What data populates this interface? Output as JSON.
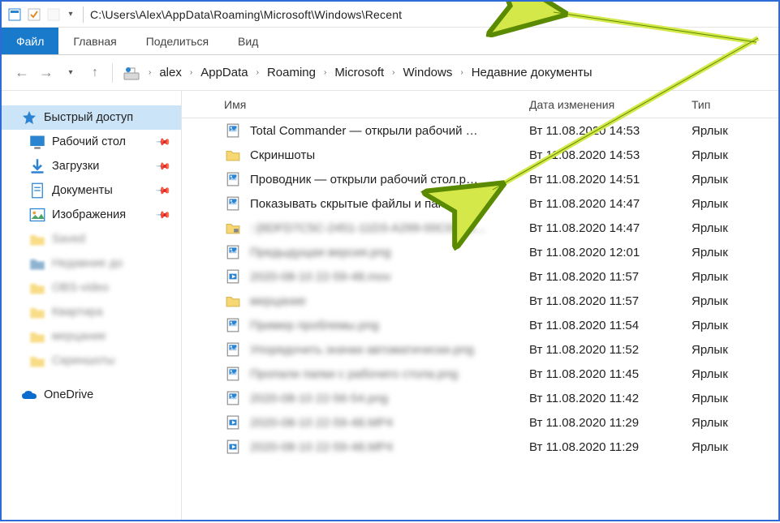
{
  "titlebar": {
    "path": "C:\\Users\\Alex\\AppData\\Roaming\\Microsoft\\Windows\\Recent"
  },
  "ribbon": {
    "file": "Файл",
    "home": "Главная",
    "share": "Поделиться",
    "view": "Вид"
  },
  "breadcrumb": {
    "items": [
      "alex",
      "AppData",
      "Roaming",
      "Microsoft",
      "Windows",
      "Недавние документы"
    ]
  },
  "sidebar": {
    "quick_access": "Быстрый доступ",
    "desktop": "Рабочий стол",
    "downloads": "Загрузки",
    "documents": "Документы",
    "pictures": "Изображения",
    "b5": "Saved",
    "b6": "Недавние до",
    "b7": "OBS-video",
    "b8": "Квартира",
    "b9": "мерцание",
    "b10": "Скриншоты",
    "onedrive": "OneDrive"
  },
  "columns": {
    "name": "Имя",
    "date": "Дата изменения",
    "type": "Тип"
  },
  "files": [
    {
      "icon": "image-file",
      "name": "Total Commander — открыли рабочий …",
      "date": "Вт 11.08.2020 14:53",
      "type": "Ярлык",
      "blur": false
    },
    {
      "icon": "folder",
      "name": "Скриншоты",
      "date": "Вт 11.08.2020 14:53",
      "type": "Ярлык",
      "blur": false
    },
    {
      "icon": "image-file",
      "name": "Проводник — открыли рабочий стол.p…",
      "date": "Вт 11.08.2020 14:51",
      "type": "Ярлык",
      "blur": false
    },
    {
      "icon": "image-file",
      "name": "Показывать скрытые файлы и папки.png",
      "date": "Вт 11.08.2020 14:47",
      "type": "Ярлык",
      "blur": false
    },
    {
      "icon": "folder-lock",
      "name": "::{6DFD7C5C-2451-11D3-A299-00C04F8…",
      "date": "Вт 11.08.2020 14:47",
      "type": "Ярлык",
      "blur": true
    },
    {
      "icon": "image-file",
      "name": "Предыдущая версия.png",
      "date": "Вт 11.08.2020 12:01",
      "type": "Ярлык",
      "blur": true,
      "prefix": "Пр"
    },
    {
      "icon": "video-file",
      "name": "2020-08-10 22-59-48.mov",
      "date": "Вт 11.08.2020 11:57",
      "type": "Ярлык",
      "blur": true,
      "prefix": "20"
    },
    {
      "icon": "folder",
      "name": "мерцание",
      "date": "Вт 11.08.2020 11:57",
      "type": "Ярлык",
      "blur": true,
      "prefix": "ме"
    },
    {
      "icon": "image-file",
      "name": "Пример проблемы.png",
      "date": "Вт 11.08.2020 11:54",
      "type": "Ярлык",
      "blur": true,
      "prefix": "Пр"
    },
    {
      "icon": "image-file",
      "name": "Упорядочить значки автоматически.png",
      "date": "Вт 11.08.2020 11:52",
      "type": "Ярлык",
      "blur": true,
      "prefix": "Уп"
    },
    {
      "icon": "image-file",
      "name": "Пропали папки с рабочего стола.png",
      "date": "Вт 11.08.2020 11:45",
      "type": "Ярлык",
      "blur": true,
      "prefix": "Пр"
    },
    {
      "icon": "image-file",
      "name": "2020-08-10 22-56-54.png",
      "date": "Вт 11.08.2020 11:42",
      "type": "Ярлык",
      "blur": true,
      "prefix": "20"
    },
    {
      "icon": "video-file",
      "name": "2020-08-10 22-59-48.MP4",
      "date": "Вт 11.08.2020 11:29",
      "type": "Ярлык",
      "blur": true,
      "prefix": "20"
    },
    {
      "icon": "video-file",
      "name": "2020-08-10 22-59-48.MP4",
      "date": "Вт 11.08.2020 11:29",
      "type": "Ярлык",
      "blur": true,
      "prefix": "20"
    }
  ]
}
